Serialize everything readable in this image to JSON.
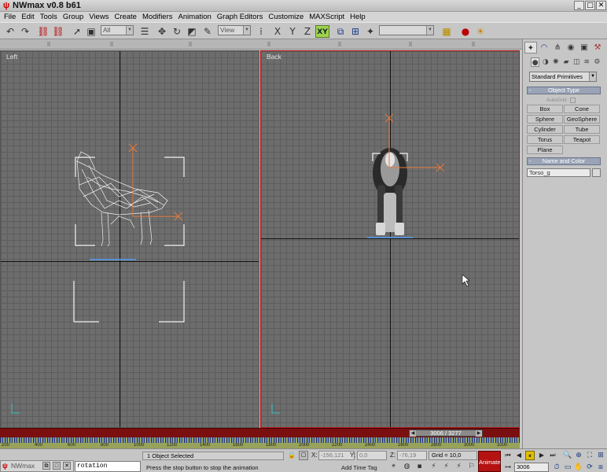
{
  "window": {
    "title": "NWmax v0.8 b61"
  },
  "menu": [
    "File",
    "Edit",
    "Tools",
    "Group",
    "Views",
    "Create",
    "Modifiers",
    "Animation",
    "Graph Editors",
    "Customize",
    "MAXScript",
    "Help"
  ],
  "toolbar": {
    "selection_filter": "All",
    "ref_coord": "View",
    "named_selection": ""
  },
  "viewports": {
    "left": {
      "label": "Left"
    },
    "back": {
      "label": "Back"
    }
  },
  "command_panel": {
    "category": "Standard Primitives",
    "object_type_header": "Object Type",
    "autogrid_label": "AutoGrid",
    "primitives": [
      "Box",
      "Cone",
      "Sphere",
      "GeoSphere",
      "Cylinder",
      "Tube",
      "Torus",
      "Teapot",
      "Plane"
    ],
    "name_color_header": "Name and Color",
    "object_name": "Torso_g"
  },
  "timeline": {
    "slider_label": "3006 / 3277",
    "ruler_ticks": [
      "200",
      "400",
      "600",
      "800",
      "1000",
      "1200",
      "1400",
      "1600",
      "1800",
      "2000",
      "2200",
      "2400",
      "2600",
      "2800",
      "3000",
      "3200"
    ]
  },
  "status": {
    "app_button": "NWmax",
    "listener_text": "rotation",
    "selection": "1 Object Selected",
    "prompt": "Press the stop button to stop the animation",
    "x_label": "X:",
    "x_value": "-156,121",
    "y_label": "Y:",
    "y_value": "0,0",
    "z_label": "Z:",
    "z_value": "-76,19",
    "grid": "Grid = 10,0",
    "add_time_tag": "Add Time Tag",
    "animate": "Animate",
    "frame": "3006"
  }
}
